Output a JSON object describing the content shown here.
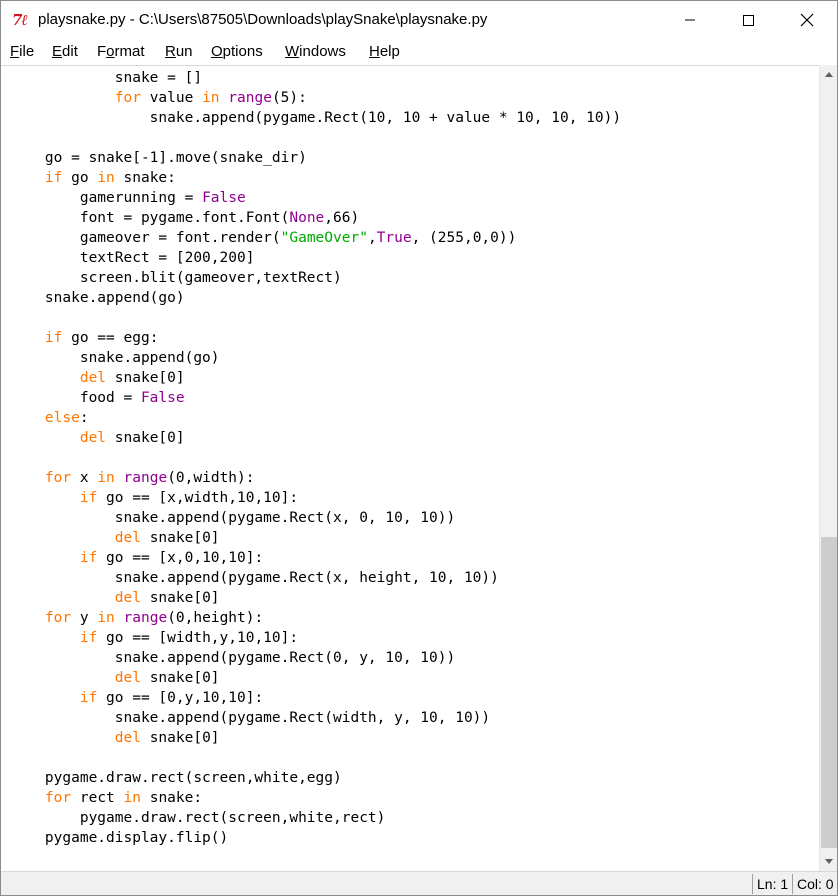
{
  "window": {
    "app_icon": "7ℓ",
    "title": "playsnake.py - C:\\Users\\87505\\Downloads\\playSnake\\playsnake.py",
    "controls": [
      "minimize-icon",
      "maximize-icon",
      "close-icon"
    ]
  },
  "menu": {
    "items": [
      {
        "acc": "F",
        "rest": "ile"
      },
      {
        "acc": "E",
        "rest": "dit"
      },
      {
        "pre": "F",
        "acc": "o",
        "rest": "rmat"
      },
      {
        "acc": "R",
        "rest": "un"
      },
      {
        "acc": "O",
        "rest": "ptions"
      },
      {
        "acc": "W",
        "rest": "indows"
      },
      {
        "acc": "H",
        "rest": "elp"
      }
    ]
  },
  "code": {
    "lines": [
      "            snake = []",
      "            for value in range(5):",
      "                snake.append(pygame.Rect(10, 10 + value * 10, 10, 10))",
      "",
      "    go = snake[-1].move(snake_dir)",
      "    if go in snake:",
      "        gamerunning = False",
      "        font = pygame.font.Font(None,66)",
      "        gameover = font.render(\"GameOver\",True, (255,0,0))",
      "        textRect = [200,200]",
      "        screen.blit(gameover,textRect)",
      "    snake.append(go)",
      "",
      "    if go == egg:",
      "        snake.append(go)",
      "        del snake[0]",
      "        food = False",
      "    else:",
      "        del snake[0]",
      "",
      "    for x in range(0,width):",
      "        if go == [x,width,10,10]:",
      "            snake.append(pygame.Rect(x, 0, 10, 10))",
      "            del snake[0]",
      "        if go == [x,0,10,10]:",
      "            snake.append(pygame.Rect(x, height, 10, 10))",
      "            del snake[0]",
      "    for y in range(0,height):",
      "        if go == [width,y,10,10]:",
      "            snake.append(pygame.Rect(0, y, 10, 10))",
      "            del snake[0]",
      "        if go == [0,y,10,10]:",
      "            snake.append(pygame.Rect(width, y, 10, 10))",
      "            del snake[0]",
      "",
      "    pygame.draw.rect(screen,white,egg)",
      "    for rect in snake:",
      "        pygame.draw.rect(screen,white,rect)",
      "    pygame.display.flip()"
    ]
  },
  "syntax_colors": {
    "keyword": "#ff7700",
    "builtin": "#900090",
    "string": "#00aa00",
    "default": "#000000"
  },
  "status": {
    "line": "Ln: 1",
    "col": "Col: 0"
  },
  "scrollbar": {
    "position_fraction": 0.6
  }
}
